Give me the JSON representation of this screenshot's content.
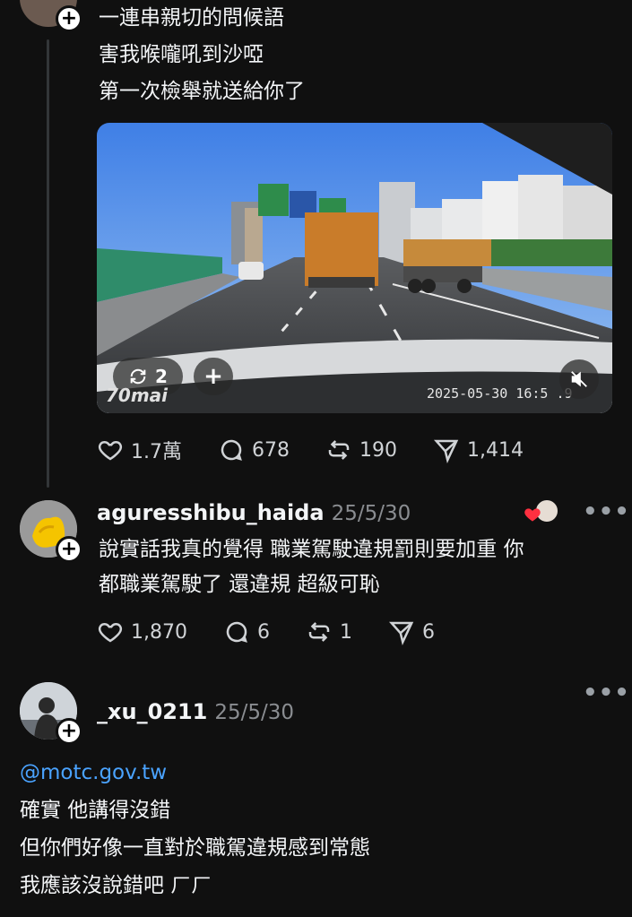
{
  "post1": {
    "lines": [
      "一連串親切的問候語",
      "害我喉嚨吼到沙啞",
      "第一次檢舉就送給你了"
    ],
    "video": {
      "repost_count": "2",
      "plus_label": "+",
      "brand": "70mai",
      "timestamp": "2025-05-30  16:5  .9"
    },
    "actions": {
      "likes": "1.7萬",
      "comments": "678",
      "reposts": "190",
      "shares": "1,414"
    }
  },
  "reply1": {
    "username": "aguresshibu_haida",
    "date": "25/5/30",
    "lines": [
      "說實話我真的覺得 職業駕駛違規罰則要加重 你",
      "都職業駕駛了 還違規 超級可恥"
    ],
    "actions": {
      "likes": "1,870",
      "comments": "6",
      "reposts": "1",
      "shares": "6"
    },
    "more": "•••"
  },
  "reply2": {
    "username": "_xu_0211",
    "date": "25/5/30",
    "mention": "@motc.gov.tw",
    "lines": [
      "確實 他講得沒錯",
      "但你們好像一直對於職駕違規感到常態",
      "我應該沒說錯吧 ㄏㄏ"
    ],
    "more": "•••"
  },
  "ui": {
    "plus": "+"
  },
  "colors": {
    "background": "#101010",
    "text": "#f3f5f7",
    "muted": "#8a8d91",
    "link": "#4aa3ff",
    "like_heart": "#ff3040"
  }
}
